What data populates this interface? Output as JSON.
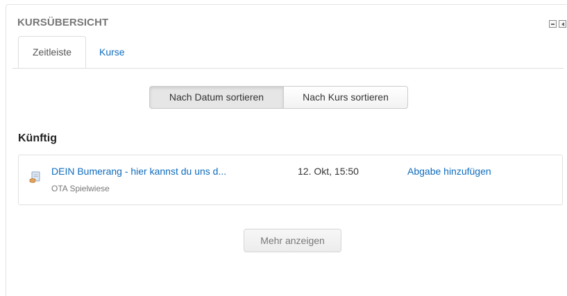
{
  "block": {
    "title": "KURSÜBERSICHT",
    "controls": {
      "minimize_icon": "minimize-icon",
      "dock_icon": "dock-icon"
    }
  },
  "tabs": [
    {
      "label": "Zeitleiste",
      "active": true
    },
    {
      "label": "Kurse",
      "active": false
    }
  ],
  "sort": {
    "by_date_label": "Nach Datum sortieren",
    "by_course_label": "Nach Kurs sortieren",
    "selected": "by_date"
  },
  "section": {
    "heading": "Künftig"
  },
  "events": [
    {
      "icon": "assignment-icon",
      "name": "DEIN Bumerang - hier kannst du uns d...",
      "course": "OTA Spielwiese",
      "date": "12. Okt, 15:50",
      "action": "Abgabe hinzufügen"
    }
  ],
  "more_button": {
    "label": "Mehr anzeigen"
  },
  "colors": {
    "link": "#0f6cbf",
    "title": "#777777",
    "border": "#dddddd"
  }
}
